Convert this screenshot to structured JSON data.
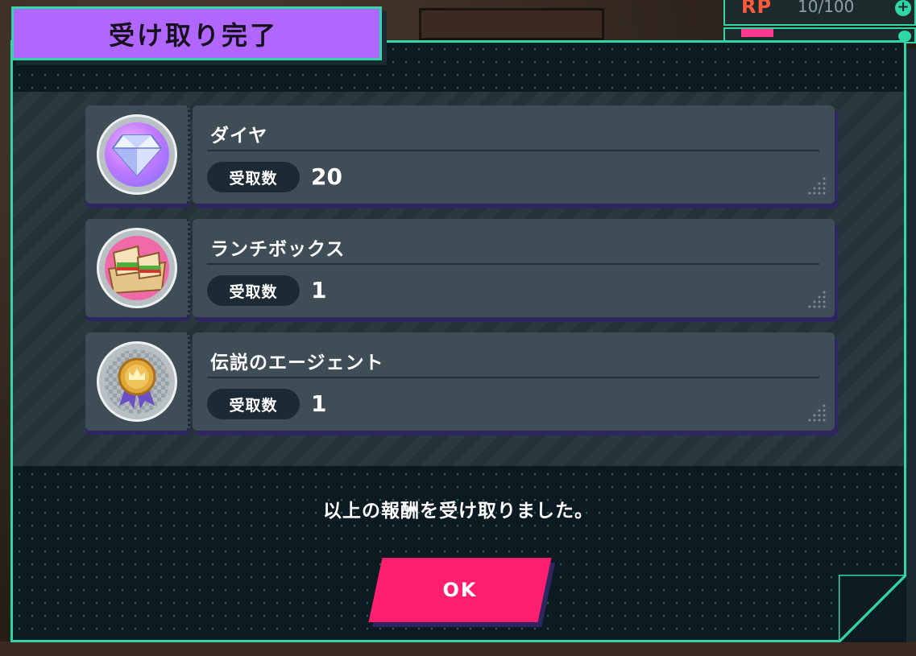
{
  "background": {
    "hud_top": {
      "label": "RP",
      "value": "10/100"
    }
  },
  "dialog": {
    "title": "受け取り完了",
    "rewards": [
      {
        "name": "ダイヤ",
        "qty_label": "受取数",
        "qty": "20",
        "icon": "diamond-icon"
      },
      {
        "name": "ランチボックス",
        "qty_label": "受取数",
        "qty": "1",
        "icon": "lunchbox-icon"
      },
      {
        "name": "伝説のエージェント",
        "qty_label": "受取数",
        "qty": "1",
        "icon": "medal-icon"
      }
    ],
    "message": "以上の報酬を受け取りました。",
    "ok_label": "OK"
  },
  "colors": {
    "accent": "#2fd7a6",
    "title_bg": "#b066ff",
    "ok_button": "#ff1f6e",
    "panel_bg": "#0c1a22",
    "card_bg": "#3f4d57"
  }
}
